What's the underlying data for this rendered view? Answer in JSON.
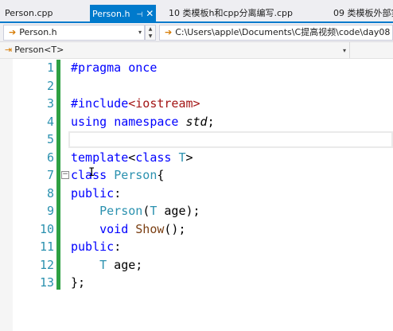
{
  "tabs": [
    {
      "label": "Person.cpp"
    },
    {
      "label": "Person.h",
      "pin_icon": "pin-icon",
      "close_icon": "close-icon"
    },
    {
      "label": "10 类模板h和cpp分离编写.cpp"
    },
    {
      "label": "09 类模板外部实"
    }
  ],
  "nav": {
    "file_combo": "Person.h",
    "path_combo": "C:\\Users\\apple\\Documents\\C提高视频\\code\\day08"
  },
  "scope": {
    "label": "Person<T>"
  },
  "editor": {
    "lines": [
      {
        "num": "1",
        "tokens": [
          {
            "t": "#pragma",
            "c": "kw"
          },
          {
            "t": " ",
            "c": "pl"
          },
          {
            "t": "once",
            "c": "kw"
          }
        ]
      },
      {
        "num": "2",
        "tokens": []
      },
      {
        "num": "3",
        "tokens": [
          {
            "t": "#include",
            "c": "kw"
          },
          {
            "t": "<iostream>",
            "c": "an"
          }
        ]
      },
      {
        "num": "4",
        "tokens": [
          {
            "t": "using",
            "c": "kw"
          },
          {
            "t": " ",
            "c": "pl"
          },
          {
            "t": "namespace",
            "c": "kw"
          },
          {
            "t": " ",
            "c": "pl"
          },
          {
            "t": "std",
            "c": "it"
          },
          {
            "t": ";",
            "c": "pl"
          }
        ]
      },
      {
        "num": "5",
        "tokens": []
      },
      {
        "num": "6",
        "tokens": [
          {
            "t": "template",
            "c": "kw"
          },
          {
            "t": "<",
            "c": "pl"
          },
          {
            "t": "class",
            "c": "kw"
          },
          {
            "t": " ",
            "c": "pl"
          },
          {
            "t": "T",
            "c": "ty"
          },
          {
            "t": ">",
            "c": "pl"
          }
        ]
      },
      {
        "num": "7",
        "tokens": [
          {
            "t": "class",
            "c": "kw"
          },
          {
            "t": " ",
            "c": "pl"
          },
          {
            "t": "Person",
            "c": "ty"
          },
          {
            "t": "{",
            "c": "pl"
          }
        ]
      },
      {
        "num": "8",
        "tokens": [
          {
            "t": "public",
            "c": "kw"
          },
          {
            "t": ":",
            "c": "pl"
          }
        ]
      },
      {
        "num": "9",
        "tokens": [
          {
            "t": "    ",
            "c": "pl"
          },
          {
            "t": "Person",
            "c": "ty"
          },
          {
            "t": "(",
            "c": "pl"
          },
          {
            "t": "T",
            "c": "ty"
          },
          {
            "t": " age);",
            "c": "pl"
          }
        ]
      },
      {
        "num": "10",
        "tokens": [
          {
            "t": "    ",
            "c": "pl"
          },
          {
            "t": "void",
            "c": "kw"
          },
          {
            "t": " ",
            "c": "pl"
          },
          {
            "t": "Show",
            "c": "fn"
          },
          {
            "t": "();",
            "c": "pl"
          }
        ]
      },
      {
        "num": "11",
        "tokens": [
          {
            "t": "public",
            "c": "kw"
          },
          {
            "t": ":",
            "c": "pl"
          }
        ]
      },
      {
        "num": "12",
        "tokens": [
          {
            "t": "    ",
            "c": "pl"
          },
          {
            "t": "T",
            "c": "ty"
          },
          {
            "t": " age;",
            "c": "pl"
          }
        ]
      },
      {
        "num": "13",
        "tokens": [
          {
            "t": "};",
            "c": "pl"
          }
        ]
      }
    ],
    "current_line": "5",
    "fold_marker_line": "7",
    "fold_glyph": "⊟"
  },
  "colors": {
    "accent": "#007acc",
    "change_bar": "#2ea043",
    "line_number": "#2b91af",
    "keyword": "#0000ff",
    "type": "#2b91af",
    "function": "#7a3e12",
    "include_path": "#a31515"
  },
  "icons": {
    "nav_arrow": "arrow-right-icon",
    "scope_icon": "class-scope-icon",
    "dropdown": "chevron-down-icon",
    "spinner": "spinner-icon"
  }
}
